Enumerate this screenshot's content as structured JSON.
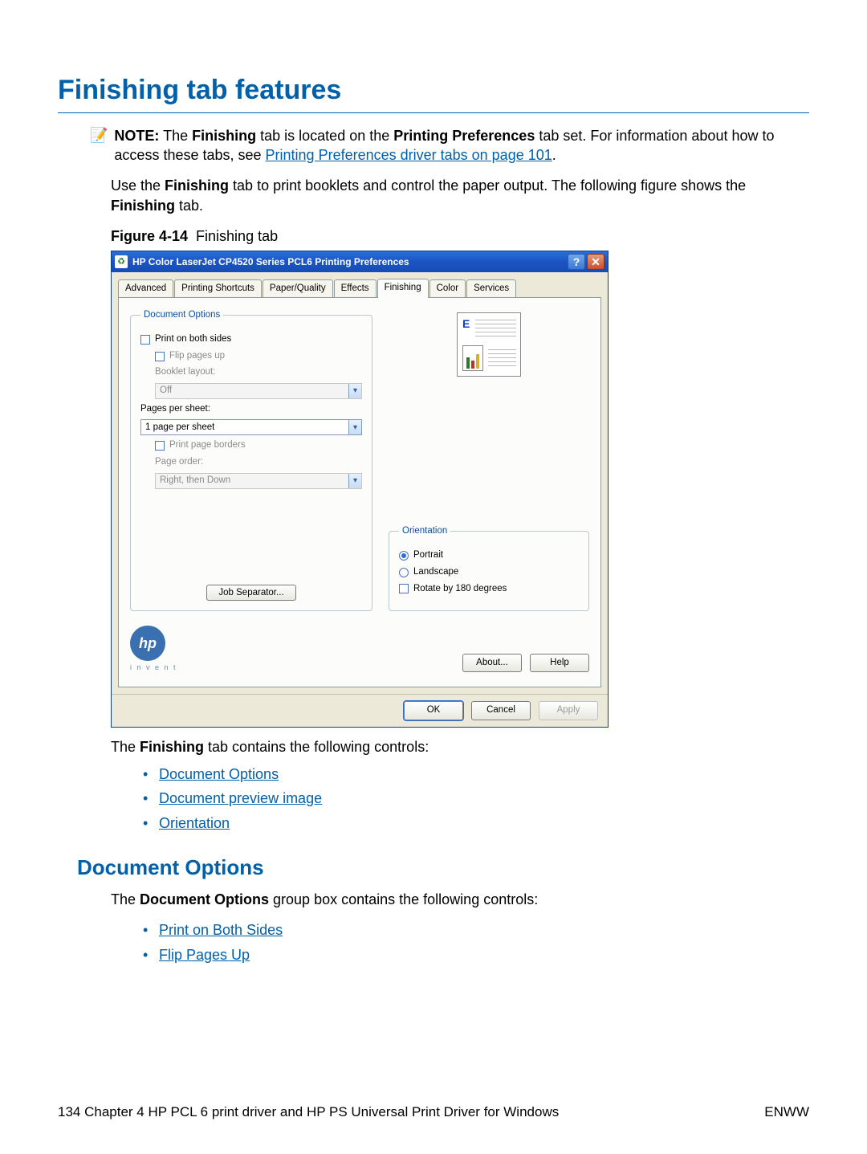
{
  "page": {
    "title": "Finishing tab features",
    "note_label": "NOTE:",
    "note_text_1": "The ",
    "note_bold_1": "Finishing",
    "note_text_2": " tab is located on the ",
    "note_bold_2": "Printing Preferences",
    "note_text_3": " tab set. For information about how to access these tabs, see ",
    "note_link": "Printing Preferences driver tabs on page 101",
    "note_text_4": ".",
    "body_para_1a": "Use the ",
    "body_para_1b": "Finishing",
    "body_para_1c": " tab to print booklets and control the paper output. The following figure shows the ",
    "body_para_1d": "Finishing",
    "body_para_1e": " tab.",
    "fig_label": "Figure 4-14",
    "fig_caption": "Finishing tab",
    "after_fig_1a": "The ",
    "after_fig_1b": "Finishing",
    "after_fig_1c": " tab contains the following controls:",
    "list1": {
      "0": "Document Options",
      "1": "Document preview image",
      "2": "Orientation"
    },
    "section2_title": "Document Options",
    "section2_para_a": "The ",
    "section2_para_b": "Document Options",
    "section2_para_c": " group box contains the following controls:",
    "list2": {
      "0": "Print on Both Sides",
      "1": "Flip Pages Up"
    }
  },
  "dialog": {
    "title": "HP Color LaserJet CP4520 Series PCL6 Printing Preferences",
    "tabs": {
      "0": "Advanced",
      "1": "Printing Shortcuts",
      "2": "Paper/Quality",
      "3": "Effects",
      "4": "Finishing",
      "5": "Color",
      "6": "Services"
    },
    "doc_options_legend": "Document Options",
    "print_both_sides": "Print on both sides",
    "flip_pages_up": "Flip pages up",
    "booklet_layout_label": "Booklet layout:",
    "booklet_value": "Off",
    "pages_per_sheet_label": "Pages per sheet:",
    "pages_per_sheet_value": "1 page per sheet",
    "print_page_borders": "Print page borders",
    "page_order_label": "Page order:",
    "page_order_value": "Right, then Down",
    "job_separator": "Job Separator...",
    "orientation_legend": "Orientation",
    "portrait": "Portrait",
    "landscape": "Landscape",
    "rotate_180": "Rotate by 180 degrees",
    "hp_invent": "i n v e n t",
    "about": "About...",
    "help": "Help",
    "ok": "OK",
    "cancel": "Cancel",
    "apply": "Apply",
    "preview_e": "E"
  },
  "footer": {
    "left": "134   Chapter 4   HP PCL 6 print driver and HP PS Universal Print Driver for Windows",
    "right": "ENWW"
  }
}
